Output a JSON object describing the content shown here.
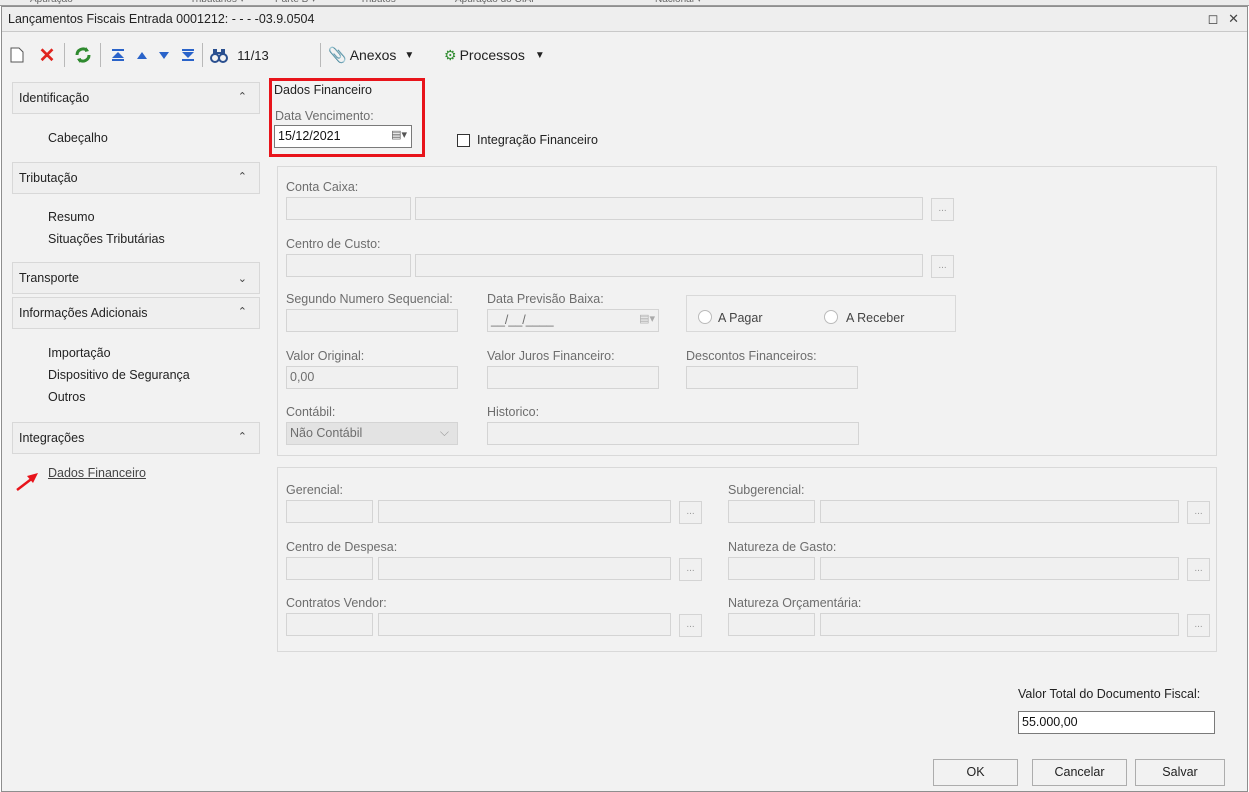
{
  "window": {
    "title": "Lançamentos Fiscais Entrada 0001212: - - - -03.9.0504"
  },
  "toolbar": {
    "record_counter": "11/13",
    "anexos_label": "Anexos",
    "processos_label": "Processos"
  },
  "sidebar": {
    "sections": [
      {
        "label": "Identificação",
        "items": [
          "Cabeçalho"
        ]
      },
      {
        "label": "Tributação",
        "items": [
          "Resumo",
          "Situações Tributárias"
        ]
      },
      {
        "label": "Transporte",
        "items": []
      },
      {
        "label": "Informações Adicionais",
        "items": [
          "Importação",
          "Dispositivo de Segurança",
          "Outros"
        ]
      },
      {
        "label": "Integrações",
        "items": [
          "Dados Financeiro"
        ]
      }
    ]
  },
  "form": {
    "group_title": "Dados Financeiro",
    "data_vencimento_label": "Data Vencimento:",
    "data_vencimento_value": "15/12/2021",
    "integracao_label": "Integração Financeiro",
    "conta_caixa_label": "Conta Caixa:",
    "centro_custo_label": "Centro de Custo:",
    "segundo_numero_label": "Segundo Numero Sequencial:",
    "data_previsao_label": "Data Previsão Baixa:",
    "data_previsao_value": "__/__/____",
    "a_pagar_label": "A Pagar",
    "a_receber_label": "A Receber",
    "valor_original_label": "Valor Original:",
    "valor_original_value": "0,00",
    "valor_juros_label": "Valor Juros Financeiro:",
    "descontos_label": "Descontos Financeiros:",
    "contabil_label": "Contábil:",
    "contabil_value": "Não Contábil",
    "historico_label": "Historico:",
    "gerencial_label": "Gerencial:",
    "subgerencial_label": "Subgerencial:",
    "centro_despesa_label": "Centro de Despesa:",
    "natureza_gasto_label": "Natureza de Gasto:",
    "contratos_vendor_label": "Contratos Vendor:",
    "natureza_orcamentaria_label": "Natureza Orçamentária:",
    "valor_total_label": "Valor Total do Documento Fiscal:",
    "valor_total_value": "55.000,00"
  },
  "buttons": {
    "ok": "OK",
    "cancelar": "Cancelar",
    "salvar": "Salvar"
  },
  "colors": {
    "highlight": "#e8141b",
    "link": "#2b2b2b"
  }
}
